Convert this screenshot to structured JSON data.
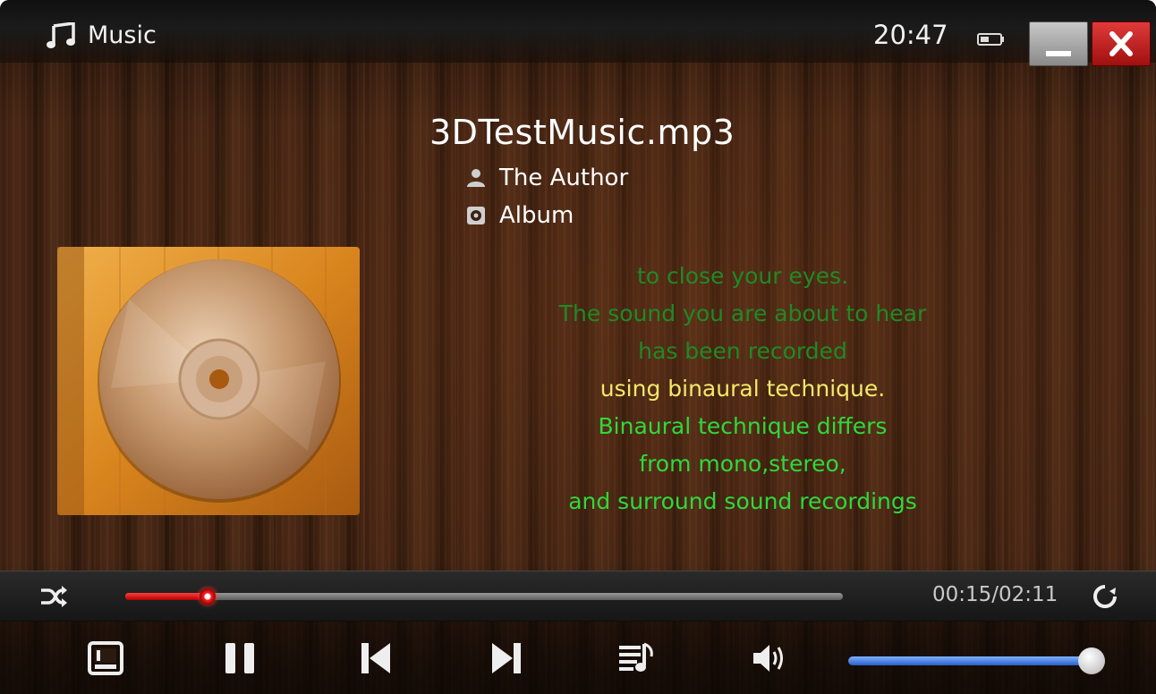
{
  "window": {
    "app_title": "Music",
    "clock": "20:47"
  },
  "track": {
    "title": "3DTestMusic.mp3",
    "artist": "The Author",
    "album": "Album"
  },
  "lyrics": [
    {
      "text": "to close your eyes.",
      "style": "dim"
    },
    {
      "text": "The sound you are about to hear",
      "style": "dim"
    },
    {
      "text": "has been recorded",
      "style": "dim"
    },
    {
      "text": "using binaural technique.",
      "style": "current"
    },
    {
      "text": "Binaural technique differs",
      "style": "green"
    },
    {
      "text": "from mono,stereo,",
      "style": "green"
    },
    {
      "text": "and surround sound recordings",
      "style": "green"
    }
  ],
  "playback": {
    "time_readout": "00:15/02:11",
    "progress_fraction": 0.115,
    "volume_fraction": 1.0,
    "state": "playing"
  },
  "icons": {
    "title": "music-note-icon",
    "battery": "battery-icon",
    "minimize": "minimize-icon",
    "close": "close-icon",
    "artist": "person-icon",
    "album": "album-icon",
    "shuffle": "shuffle-icon",
    "repeat": "repeat-icon",
    "view": "view-mode-icon",
    "pause": "pause-icon",
    "previous": "previous-track-icon",
    "next": "next-track-icon",
    "playlist": "playlist-icon",
    "volume": "volume-icon"
  },
  "colors": {
    "progress": "#e01010",
    "volume": "#3a78e0",
    "lyric_current": "#f4e96a",
    "lyric_upcoming": "#2ed93a",
    "lyric_past": "#1f8a25",
    "close_button": "#c01818"
  }
}
